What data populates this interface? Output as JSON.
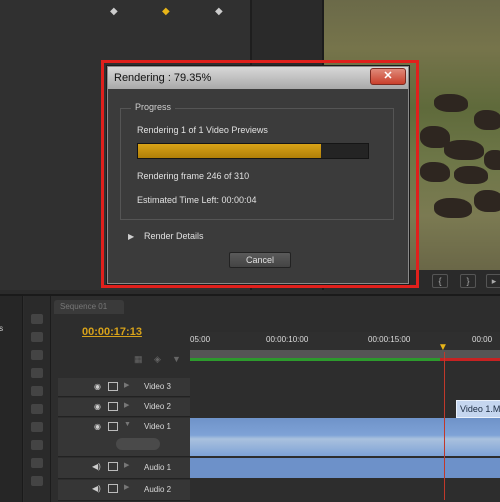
{
  "dialog": {
    "title": "Rendering : 79.35%",
    "close_icon": "close-icon",
    "progress_group_label": "Progress",
    "task_text": "Rendering 1 of 1 Video Previews",
    "progress_percent": 79.35,
    "frame_text": "Rendering frame 246 of 310",
    "eta_text": "Estimated Time Left: 00:00:04",
    "details_label": "Render Details",
    "cancel_label": "Cancel"
  },
  "timeline": {
    "sequence_tab": "Sequence 01",
    "timecode": "00:00:17:13",
    "ruler_ticks": [
      "05:00",
      "00:00:10:00",
      "00:00:15:00",
      "00:00"
    ],
    "project_label": "ems",
    "tracks": {
      "v3": "Video 3",
      "v2": "Video 2",
      "v1": "Video 1",
      "a1": "Audio 1",
      "a2": "Audio 2"
    },
    "v1_target": "V",
    "clip_label": "Video 1.M"
  },
  "colors": {
    "accent_timecode": "#d7a21a",
    "progress_fill": "#c99010",
    "highlight": "#e0201c",
    "clip_blue": "#7ea2d6"
  }
}
